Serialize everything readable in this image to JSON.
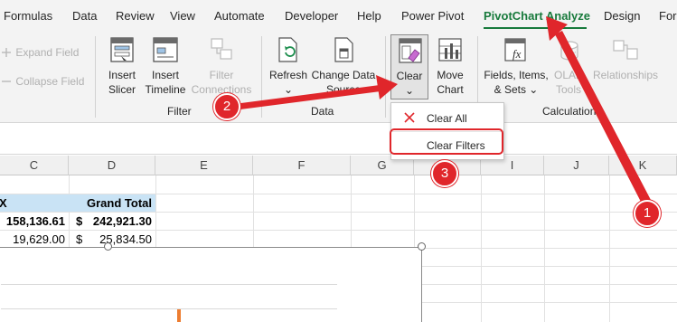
{
  "tabs": [
    "Formulas",
    "Data",
    "Review",
    "View",
    "Automate",
    "Developer",
    "Help",
    "Power Pivot",
    "PivotChart Analyze",
    "Design",
    "For"
  ],
  "active_tab": "PivotChart Analyze",
  "ribbon": {
    "expand_field": "Expand Field",
    "collapse_field": "Collapse Field",
    "filter_group": {
      "label": "Filter",
      "insert_slicer": [
        "Insert",
        "Slicer"
      ],
      "insert_timeline": [
        "Insert",
        "Timeline"
      ],
      "filter_connections": [
        "Filter",
        "Connections"
      ]
    },
    "data_group": {
      "label": "Data",
      "refresh": [
        "Refresh",
        "⌄"
      ],
      "change_data_source": [
        "Change Data",
        "Source"
      ]
    },
    "actions_group": {
      "clear": [
        "Clear",
        "⌄"
      ],
      "move_chart": [
        "Move",
        "Chart"
      ]
    },
    "calculations_group": {
      "label": "Calculations",
      "fields_items_sets": [
        "Fields, Items,",
        "& Sets ⌄"
      ],
      "olap_tools": [
        "OLAP",
        "Tools"
      ],
      "relationships": "Relationships"
    }
  },
  "dropdown": {
    "clear_all": "Clear All",
    "clear_filters": "Clear Filters"
  },
  "sheet": {
    "columns": [
      "C",
      "D",
      "E",
      "F",
      "G",
      "H",
      "I",
      "J",
      "K"
    ],
    "header_row": {
      "b": "X",
      "d": "Grand Total"
    },
    "row1": {
      "c": "158,136.61",
      "d_sym": "$",
      "d": "242,921.30"
    },
    "row2": {
      "c": "19,629.00",
      "d_sym": "$",
      "d": "25,834.50"
    }
  },
  "annotations": [
    "1",
    "2",
    "3"
  ],
  "colors": {
    "accent_green": "#187a3c",
    "annotation_red": "#e0262b",
    "pivot_header_blue": "#c9e3f5",
    "bar_orange": "#ed7d31"
  }
}
